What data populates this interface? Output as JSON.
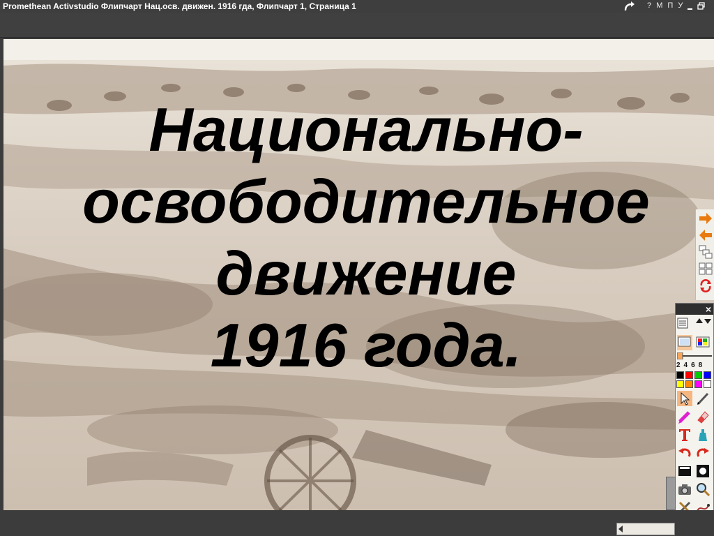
{
  "window": {
    "title": "Promethean Activstudio   Флипчарт  Нац.осв. движен. 1916 гда,  Флипчарт 1,  Страница 1",
    "buttons": [
      "?",
      "М",
      "П",
      "У"
    ]
  },
  "slide": {
    "title_lines": [
      "Национально-",
      "освободительное",
      "движение",
      "1916 года."
    ]
  },
  "toolbox": {
    "pen_widths": "2468",
    "palette": [
      "#000000",
      "#ff0000",
      "#00cc00",
      "#0000ff",
      "#ffff00",
      "#ff8800",
      "#ff00ff",
      "#ffffff"
    ]
  },
  "colors": {
    "title_bar": "#3e3e3e",
    "slide_sepia": "#ddd3c8",
    "nav_arrow": "#e87a10"
  }
}
